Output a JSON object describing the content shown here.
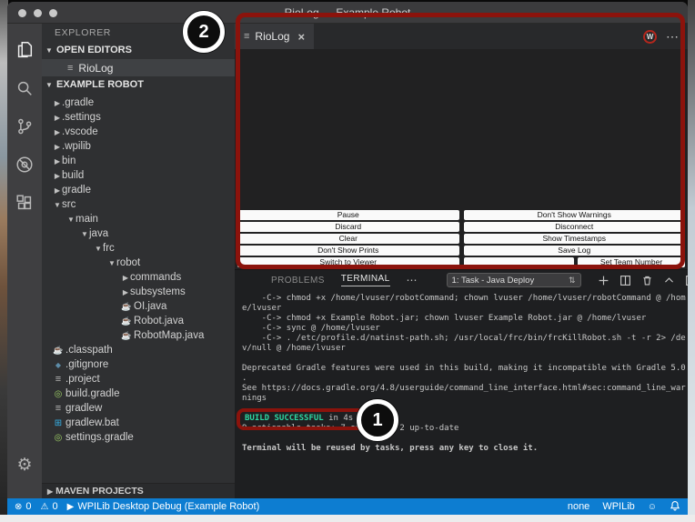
{
  "window": {
    "title": "RioLog — Example Robot"
  },
  "activity_bar": {
    "icons": [
      "explorer-icon",
      "search-icon",
      "source-control-icon",
      "debug-icon",
      "extensions-icon"
    ],
    "bottom_icon": "settings-gear-icon"
  },
  "sidebar": {
    "title": "EXPLORER",
    "open_editors_label": "OPEN EDITORS",
    "open_editor_item": "RioLog",
    "project_label": "EXAMPLE ROBOT",
    "tree": [
      {
        "label": ".gradle",
        "indent": 1,
        "marker": "collapsed"
      },
      {
        "label": ".settings",
        "indent": 1,
        "marker": "collapsed"
      },
      {
        "label": ".vscode",
        "indent": 1,
        "marker": "collapsed"
      },
      {
        "label": ".wpilib",
        "indent": 1,
        "marker": "collapsed"
      },
      {
        "label": "bin",
        "indent": 1,
        "marker": "collapsed"
      },
      {
        "label": "build",
        "indent": 1,
        "marker": "collapsed"
      },
      {
        "label": "gradle",
        "indent": 1,
        "marker": "collapsed"
      },
      {
        "label": "src",
        "indent": 1,
        "marker": "expanded"
      },
      {
        "label": "main",
        "indent": 2,
        "marker": "expanded"
      },
      {
        "label": "java",
        "indent": 3,
        "marker": "expanded"
      },
      {
        "label": "frc",
        "indent": 4,
        "marker": "expanded"
      },
      {
        "label": "robot",
        "indent": 5,
        "marker": "expanded"
      },
      {
        "label": "commands",
        "indent": 6,
        "marker": "collapsed"
      },
      {
        "label": "subsystems",
        "indent": 6,
        "marker": "collapsed"
      },
      {
        "label": "OI.java",
        "indent": 6,
        "icon": "java"
      },
      {
        "label": "Robot.java",
        "indent": 6,
        "icon": "java"
      },
      {
        "label": "RobotMap.java",
        "indent": 6,
        "icon": "java"
      },
      {
        "label": ".classpath",
        "indent": 1,
        "icon": "java"
      },
      {
        "label": ".gitignore",
        "indent": 1,
        "icon": "diamond"
      },
      {
        "label": ".project",
        "indent": 1,
        "icon": "lines"
      },
      {
        "label": "build.gradle",
        "indent": 1,
        "icon": "gradle"
      },
      {
        "label": "gradlew",
        "indent": 1,
        "icon": "lines"
      },
      {
        "label": "gradlew.bat",
        "indent": 1,
        "icon": "windows"
      },
      {
        "label": "settings.gradle",
        "indent": 1,
        "icon": "gradle"
      }
    ],
    "maven_label": "MAVEN PROJECTS"
  },
  "editor": {
    "tab_label": "RioLog",
    "wpilib_badge": "W",
    "more_actions": "⋯"
  },
  "riolog": {
    "buttons_left": [
      "Pause",
      "Discard",
      "Clear",
      "Don't Show Prints",
      "Switch to Viewer"
    ],
    "buttons_right": [
      "Don't Show Warnings",
      "Disconnect",
      "Show Timestamps",
      "Save Log"
    ],
    "team_number_value": "",
    "set_team_button": "Set Team Number"
  },
  "terminal": {
    "tab_problems": "PROBLEMS",
    "tab_terminal": "TERMINAL",
    "overflow": "⋯",
    "task_dropdown": "1: Task - Java Deploy",
    "dropdown_arrows": "⇅",
    "lines_before": [
      "    -C-> chmod +x /home/lvuser/robotCommand; chown lvuser /home/lvuser/robotCommand @ /hom",
      "e/lvuser",
      "    -C-> chmod +x Example Robot.jar; chown lvuser Example Robot.jar @ /home/lvuser",
      "    -C-> sync @ /home/lvuser",
      "    -C-> . /etc/profile.d/natinst-path.sh; /usr/local/frc/bin/frcKillRobot.sh -t -r 2> /de",
      "v/null @ /home/lvuser",
      "",
      "Deprecated Gradle features were used in this build, making it incompatible with Gradle 5.0",
      ".",
      "See https://docs.gradle.org/4.8/userguide/command_line_interface.html#sec:command_line_war",
      "nings",
      ""
    ],
    "build_success": "BUILD SUCCESSFUL",
    "build_suffix": " in 4s",
    "lines_after": [
      "9 actionable tasks: 7 executed, 2 up-to-date",
      ""
    ],
    "reuse_line": "Terminal will be reused by tasks, press any key to close it."
  },
  "status_bar": {
    "errors": "0",
    "warnings": "0",
    "launch": "WPILib Desktop Debug (Example Robot)",
    "right_items": [
      "none",
      "WPILib"
    ]
  },
  "annotations": {
    "step1": "1",
    "step2": "2"
  },
  "colors": {
    "status_bar_blue": "#0d7dd1",
    "annotation_red": "#8b130c",
    "build_success_green": "#2ed8a3",
    "java_icon_red": "#d35f4f",
    "gradle_icon_green": "#9ccc65",
    "windows_icon_blue": "#35b1e8",
    "wpilib_badge_red": "#b5271d"
  }
}
